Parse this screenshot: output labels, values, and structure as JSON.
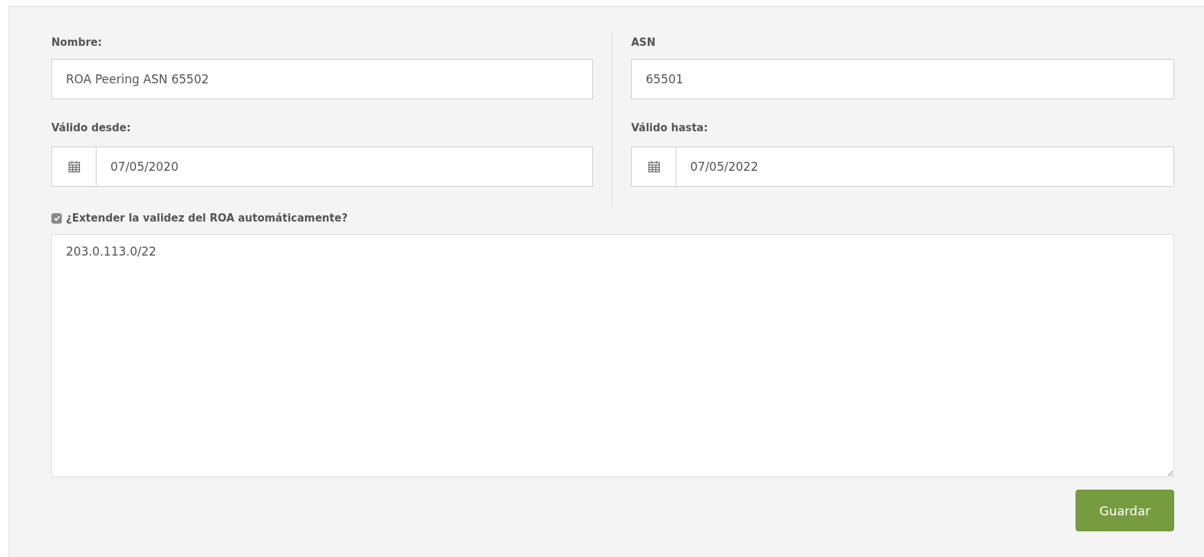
{
  "form": {
    "left": [
      {
        "kind": "text",
        "label": "Nombre:",
        "value": "ROA Peering ASN 65502"
      },
      {
        "kind": "date",
        "label": "Válido desde:",
        "value": "07/05/2020"
      }
    ],
    "right": [
      {
        "kind": "text",
        "label": "ASN",
        "value": "65501"
      },
      {
        "kind": "date",
        "label": "Válido hasta:",
        "value": "07/05/2022"
      }
    ],
    "auto_extend": {
      "label": "¿Extender la validez del ROA automáticamente?",
      "checked": true
    },
    "prefixes": {
      "value": "203.0.113.0/22"
    },
    "buttons": [
      {
        "label": "Guardar"
      }
    ]
  }
}
